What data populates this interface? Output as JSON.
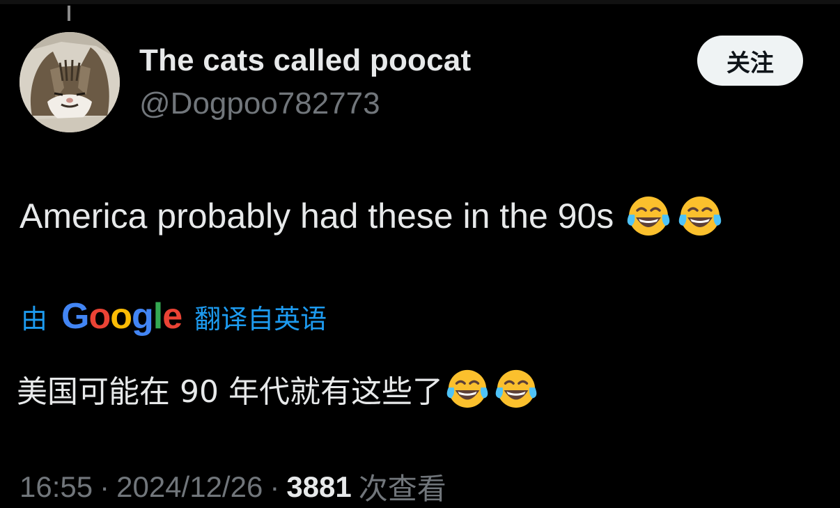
{
  "user": {
    "display_name": "The cats called poocat",
    "handle": "@Dogpoo782773",
    "avatar_icon": "cat-avatar"
  },
  "follow_button": {
    "label": "关注"
  },
  "tweet": {
    "text": "America probably had these in the 90s",
    "emojis": [
      "face-with-tears-of-joy",
      "face-with-tears-of-joy"
    ]
  },
  "translation": {
    "by_label": "由",
    "provider_letters": [
      "G",
      "o",
      "o",
      "g",
      "l",
      "e"
    ],
    "from_label": "翻译自英语",
    "text": "美国可能在 90 年代就有这些了"
  },
  "meta": {
    "time": "16:55",
    "separator": "·",
    "date": "2024/12/26",
    "views": "3881",
    "views_label": "次查看"
  },
  "colors": {
    "background": "#000000",
    "text": "#e7e9ea",
    "muted": "#71767b",
    "link": "#1d9bf0",
    "follow_bg": "#eff3f4"
  }
}
